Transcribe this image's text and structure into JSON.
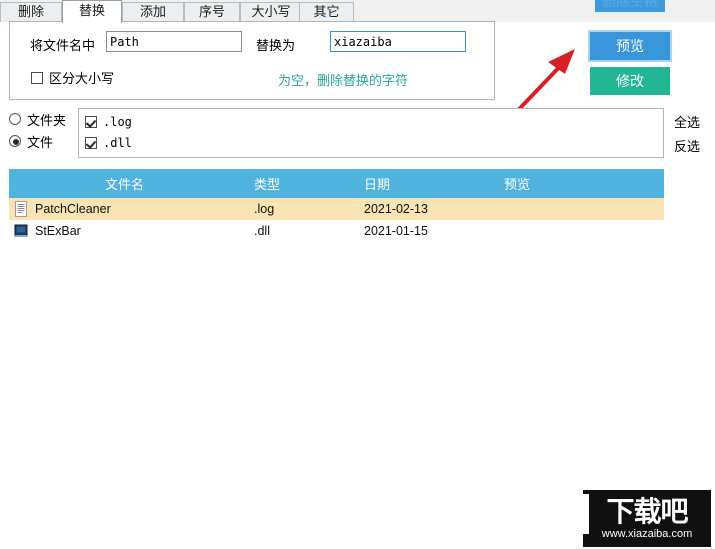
{
  "tabs": [
    {
      "label": "删除",
      "active": false
    },
    {
      "label": "替换",
      "active": true
    },
    {
      "label": "添加",
      "active": false
    },
    {
      "label": "序号",
      "active": false
    },
    {
      "label": "大小写",
      "active": false
    },
    {
      "label": "其它",
      "active": false
    }
  ],
  "replace_panel": {
    "find_label": "将文件名中",
    "find_value": "Path",
    "replace_label": "替换为",
    "replace_value": "xiazaiba",
    "case_sensitive_label": "区分大小写",
    "case_sensitive_checked": false,
    "hint": "为空，删除替换的字符"
  },
  "buttons": {
    "top_label": "删除空格",
    "preview_label": "预览",
    "modify_label": "修改"
  },
  "colors": {
    "blue_button": "#3896d8",
    "green_button": "#22b694",
    "table_header": "#4fb3dd",
    "selected_row": "#fae3b5",
    "hint_text": "#2aa693",
    "arrow": "#d61f26"
  },
  "target_type": {
    "folder_label": "文件夹",
    "folder_selected": false,
    "file_label": "文件",
    "file_selected": true
  },
  "extensions": [
    {
      "label": ".log",
      "checked": true
    },
    {
      "label": ".dll",
      "checked": true
    }
  ],
  "selection_links": {
    "select_all": "全选",
    "invert": "反选"
  },
  "table": {
    "columns": [
      "文件名",
      "类型",
      "日期",
      "预览"
    ],
    "rows": [
      {
        "name": "PatchCleaner",
        "type": ".log",
        "date": "2021-02-13",
        "preview": "",
        "icon": "text-file-icon",
        "selected": true
      },
      {
        "name": "StExBar",
        "type": ".dll",
        "date": "2021-01-15",
        "preview": "",
        "icon": "system-file-icon",
        "selected": false
      }
    ]
  },
  "watermark": {
    "title": "下载吧",
    "url": "www.xiazaiba.com"
  }
}
